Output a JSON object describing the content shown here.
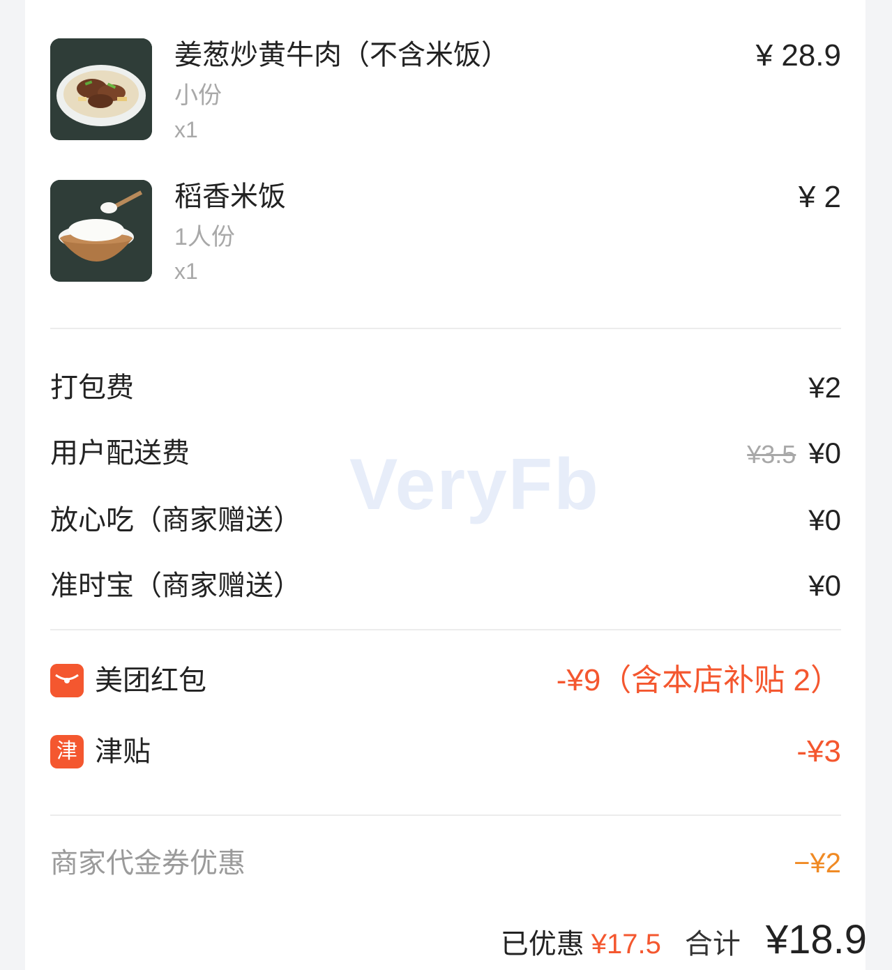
{
  "order_items": [
    {
      "name": "姜葱炒黄牛肉（不含米饭）",
      "spec": "小份",
      "qty": "x1",
      "price": "¥ 28.9",
      "image": "beef-dish-photo"
    },
    {
      "name": "稻香米饭",
      "spec": "1人份",
      "qty": "x1",
      "price": "¥ 2",
      "image": "rice-bowl-photo"
    }
  ],
  "fees": {
    "packaging": {
      "label": "打包费",
      "value": "¥2"
    },
    "delivery": {
      "label": "用户配送费",
      "original": "¥3.5",
      "value": "¥0"
    },
    "worry_free": {
      "label": "放心吃（商家赠送）",
      "value": "¥0"
    },
    "on_time": {
      "label": "准时宝（商家赠送）",
      "value": "¥0"
    }
  },
  "discounts": {
    "red_packet": {
      "icon": "red-envelope-icon",
      "label": "美团红包",
      "value": "-¥9（含本店补贴 2）"
    },
    "subsidy": {
      "icon_text": "津",
      "label": "津贴",
      "value": "-¥3"
    },
    "voucher": {
      "label": "商家代金券优惠",
      "value": "−¥2"
    }
  },
  "summary": {
    "saved_label": "已优惠",
    "saved_value": "¥17.5",
    "total_label": "合计",
    "total_value": "¥18.9"
  },
  "watermark": "VeryFb",
  "colors": {
    "accent": "#f4572f",
    "voucher": "#f08a24",
    "muted": "#a8a8a8"
  }
}
